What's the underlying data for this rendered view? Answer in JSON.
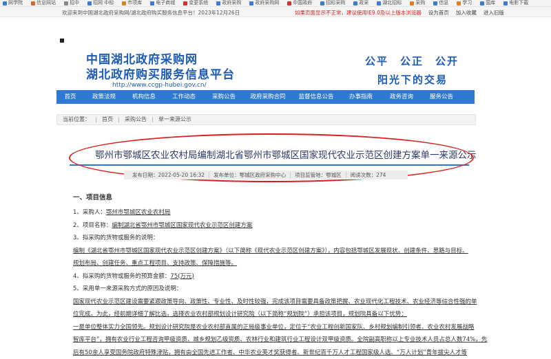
{
  "bookmarks": [
    {
      "label": "网学院",
      "color": "#3a7bd5"
    },
    {
      "label": "信息网站",
      "color": "#e06030"
    },
    {
      "label": "招中",
      "color": "#888888"
    },
    {
      "label": "招网 中标",
      "color": "#3a7bd5"
    },
    {
      "label": "市项库",
      "color": "#e08020"
    },
    {
      "label": "电子商城",
      "color": "#3a7bd5"
    },
    {
      "label": "变更系统",
      "color": "#d03030"
    },
    {
      "label": "政府采购",
      "color": "#3a7bd5"
    },
    {
      "label": "政府采购网",
      "color": "#3a7bd5"
    },
    {
      "label": "中国政府",
      "color": "#d03030"
    },
    {
      "label": "招标采购",
      "color": "#3a7bd5"
    },
    {
      "label": "政采",
      "color": "#3a7bd5"
    },
    {
      "label": "湖北招标",
      "color": "#3a7bd5"
    },
    {
      "label": "采购",
      "color": "#e08020"
    },
    {
      "label": "信息",
      "color": "#3a7bd5"
    },
    {
      "label": "学习",
      "color": "#e08020"
    },
    {
      "label": "国库",
      "color": "#3a7bd5"
    },
    {
      "label": "电影下载",
      "color": "#3a7bd5"
    }
  ],
  "topbar": {
    "welcome": "欢迎来到中国湖北政府采购网/湖北政府购买服务信息平台！2023年12月26日",
    "warning": "如果页面显示不正常，建议使用IE9.0及以上版本浏览器",
    "links": [
      "设为首页",
      "加入收藏",
      "进入旧版"
    ]
  },
  "header": {
    "title1": "中国湖北政府采购网",
    "title2": "湖北政府购买服务信息平台",
    "url": "http://www.ccgp-hubei.gov.cn/",
    "slogan1": "公平　公正　公开",
    "slogan2": "阳光下的交易"
  },
  "nav": [
    "首页",
    "政策法规",
    "机构信息",
    "工作动态",
    "采购公告",
    "政府采购合同",
    "监督信息公告",
    "办事指南",
    "政务咨询",
    "服务公告"
  ],
  "breadcrumb": {
    "label": "当前位置：",
    "items": [
      "首页",
      "采购公告",
      "单一来源公示"
    ]
  },
  "article": {
    "title": "鄂州市鄂城区农业农村局编制湖北省鄂州市鄂城区国家现代农业示范区创建方案单一来源公示",
    "meta": [
      "发布日期：2022-05-20 16:32",
      "发布单位：鄂城区政府采购中心",
      "项目监管地：鄂城区",
      "阅读次数：274"
    ],
    "section1": "一、项目信息",
    "lines": [
      {
        "pre": "1、采购人：",
        "val": "鄂州市鄂城区农业农村局"
      },
      {
        "pre": "2、项目名称：",
        "val": "编制湖北省鄂州市鄂城区国家现代农业示范区创建方案"
      },
      {
        "pre": "3、拟采购的货物或服务的说明：",
        "val": ""
      },
      {
        "pre": "",
        "val": "编制《湖北省鄂州市鄂城区国家现代农业示范区创建方案》（以下简称《现代农业示范区创建方案》），内容包括鄂城区发展现状、创建条件、思路与目标、"
      },
      {
        "pre": "",
        "val": "规划布局、创建任务、重点工程项目、支持政策、保障措施等。"
      },
      {
        "pre": "4、拟采购的货物或服务的预算金额：",
        "val": "75(万元)"
      },
      {
        "pre": "5、采用单一来源采购方式的原因及说明：",
        "val": ""
      },
      {
        "pre": "",
        "val": "国家现代农业示范区建设需要紧跟政策导向、政策性、专业性、及时性较强，完成该项目需要具备政策把握、农业现代化工程技术、农业经济等综合性强的单"
      },
      {
        "pre": "",
        "val": "位完成。为此，经前期详细了解比选，选择农业农村部规划设计研究院（以下简称“规划院”）承担该项目，规划院具备以下优势："
      },
      {
        "pre": "",
        "val": "一是单位整体实力全国领先。规划设计研究院是农业农村部直属的正局级事业单位，定位于“农业工程创新国家队、乡村规划编制引领者、农业农村发展战略"
      },
      {
        "pre": "",
        "val": "智库平台”，拥有农业行业工程咨询甲级资质、城乡规划乙级资质、农林行业和建筑行业工程设计双甲级资质。全院副高职称以上专业技术人员占总人数74%，先"
      },
      {
        "pre": "",
        "val": "后有50余人享受国务院政府特殊津贴，拥有由全国先进工作者、中华农业英才奖获得者、新世纪百千万人才工程国家级人选、“万人计划”青年拔尖人才等"
      }
    ]
  }
}
